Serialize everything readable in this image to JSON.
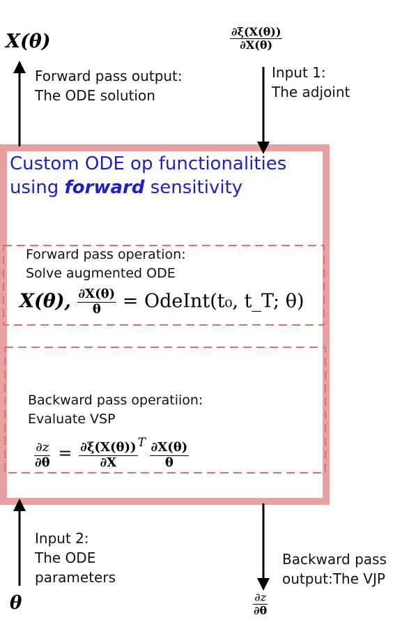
{
  "top_left": {
    "output_symbol": "X(θ)",
    "output_label_line1": "Forward pass output:",
    "output_label_line2": "The ODE solution"
  },
  "top_right": {
    "adjoint_num": "∂ξ(X(θ))",
    "adjoint_den": "∂X(θ)",
    "input_label_line1": "Input 1:",
    "input_label_line2": "The adjoint"
  },
  "main_box": {
    "title_line1": "Custom ODE op functionalities",
    "title_line2_pre": "using ",
    "title_line2_emph": "forward",
    "title_line2_post": " sensitivity",
    "colors": {
      "title": "#1f1fc8",
      "border": "#e8a0a0",
      "dashed": "#e07070"
    }
  },
  "forward_op": {
    "line1": "Forward pass operation:",
    "line2": "Solve augmented ODE",
    "eq_lhs": "X(θ),",
    "eq_frac_num": "∂X(θ)",
    "eq_frac_den": "θ",
    "eq_rhs": "= OdeInt(t₀, t_T; θ)"
  },
  "backward_op": {
    "line1": "Backward pass operatiion:",
    "line2": "Evaluate VSP",
    "eq_lhs_num": "∂z",
    "eq_lhs_den": "∂θ",
    "eq_eq": "=",
    "eq_f1_num": "∂ξ(X(θ))",
    "eq_f1_den": "∂X",
    "eq_sup": "T",
    "eq_f2_num": "∂X(θ)",
    "eq_f2_den": "θ"
  },
  "bottom_left": {
    "input_label_line1": "Input 2:",
    "input_label_line2": "The ODE",
    "input_label_line3": "parameters",
    "param_symbol": "θ"
  },
  "bottom_right": {
    "output_label_line1": "Backward pass",
    "output_label_line2": "output:The VJP",
    "vjp_num": "∂z",
    "vjp_den": "∂θ"
  }
}
